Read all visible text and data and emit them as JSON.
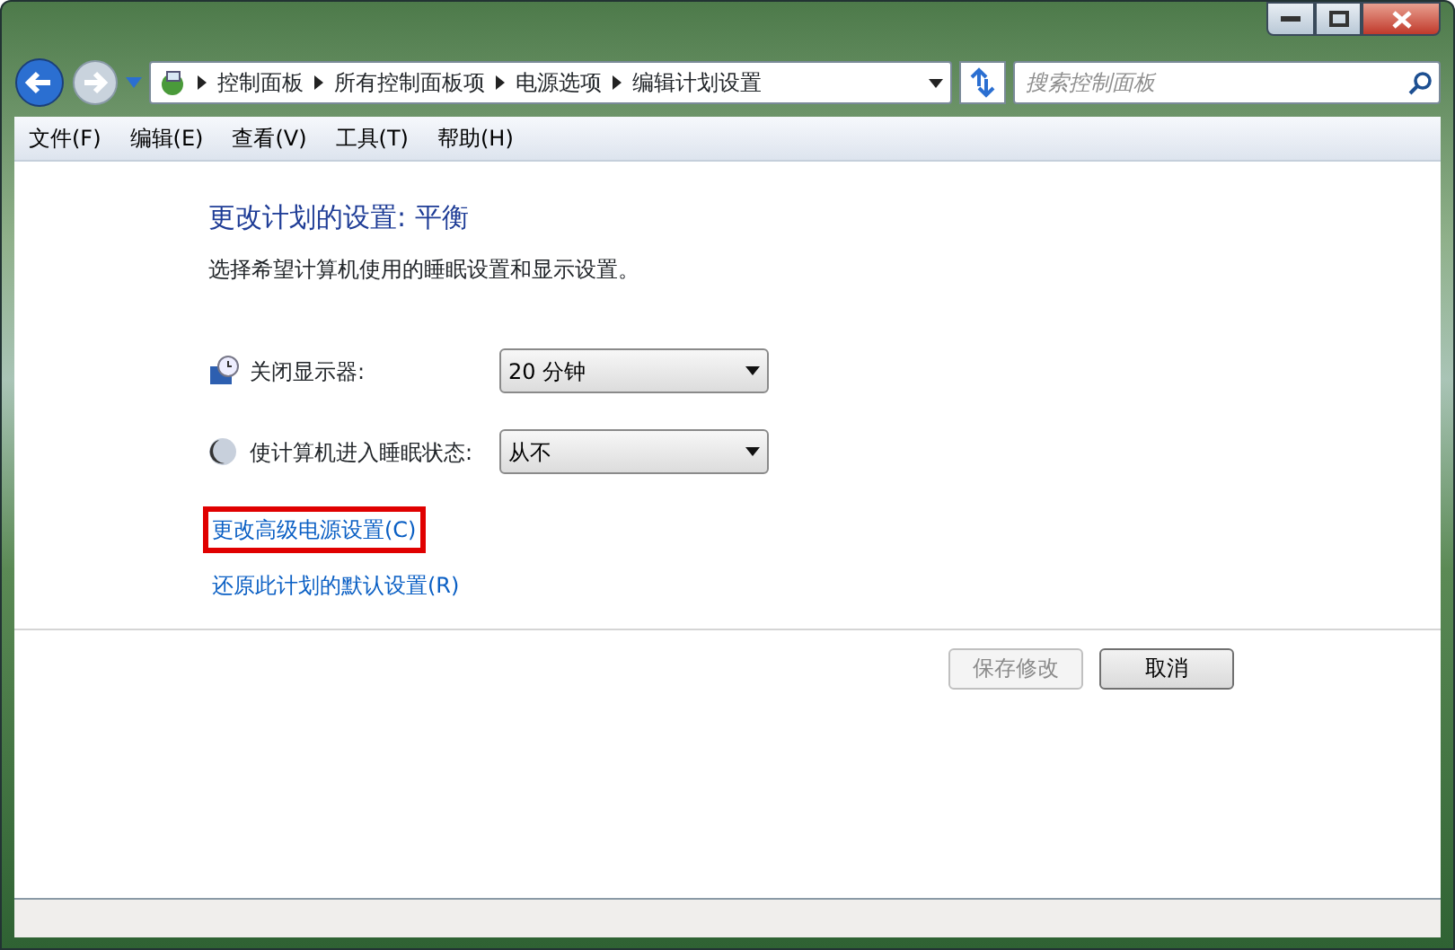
{
  "address_bar": {
    "breadcrumb": [
      "控制面板",
      "所有控制面板项",
      "电源选项",
      "编辑计划设置"
    ]
  },
  "search": {
    "placeholder": "搜索控制面板"
  },
  "menu": [
    "文件(F)",
    "编辑(E)",
    "查看(V)",
    "工具(T)",
    "帮助(H)"
  ],
  "content": {
    "title": "更改计划的设置: 平衡",
    "description": "选择希望计算机使用的睡眠设置和显示设置。",
    "settings": [
      {
        "kind": "display",
        "label": "关闭显示器:",
        "value": "20 分钟"
      },
      {
        "kind": "sleep",
        "label": "使计算机进入睡眠状态:",
        "value": "从不"
      }
    ],
    "links": [
      {
        "label": "更改高级电源设置(C)",
        "highlighted": true
      },
      {
        "label": "还原此计划的默认设置(R)",
        "highlighted": false
      }
    ],
    "buttons": [
      {
        "label": "保存修改",
        "disabled": true
      },
      {
        "label": "取消",
        "disabled": false
      }
    ]
  }
}
